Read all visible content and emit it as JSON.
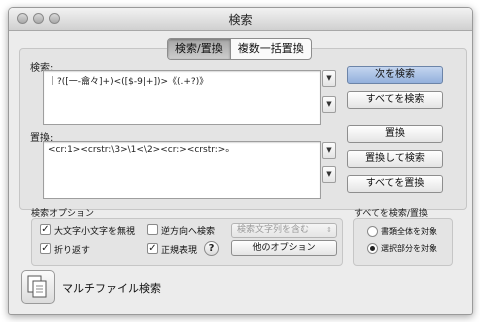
{
  "window": {
    "title": "検索"
  },
  "tabs": [
    {
      "label": "検索/置換"
    },
    {
      "label": "複数一括置換"
    }
  ],
  "search": {
    "label": "検索:",
    "value": "｜?([一-龠々]+)<([$-9|+])>《(.+?)》"
  },
  "replace": {
    "label": "置換:",
    "value": "<cr:1><crstr:\\3>\\1<\\2><cr:><crstr:>ₒ"
  },
  "buttons": {
    "find_next": "次を検索",
    "find_all": "すべてを検索",
    "replace": "置換",
    "replace_and_find": "置換して検索",
    "replace_all": "すべてを置換"
  },
  "options": {
    "title": "検索オプション",
    "ignore_case": {
      "label": "大文字小文字を無視",
      "checked": true
    },
    "backwards": {
      "label": "逆方向へ検索",
      "checked": false
    },
    "wrap": {
      "label": "折り返す",
      "checked": true
    },
    "regex": {
      "label": "正規表現",
      "checked": true
    },
    "help": "?",
    "include_popup": "検索文字列を含む",
    "other_options": "他のオプション"
  },
  "scope": {
    "title": "すべてを検索/置換",
    "whole_document": {
      "label": "書類全体を対象",
      "selected": false
    },
    "selection": {
      "label": "選択部分を対象",
      "selected": true
    }
  },
  "multifile": {
    "label": "マルチファイル検索",
    "icon": "documents-icon"
  },
  "icons": {
    "dropdown": "▼",
    "check": "✓",
    "popup": "⇕"
  }
}
